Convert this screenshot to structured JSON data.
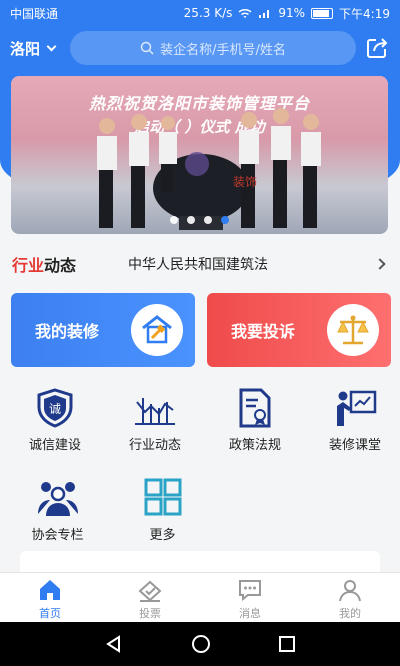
{
  "status_bar": {
    "carrier": "中国联通",
    "speed": "25.3 K/s",
    "battery": "91%",
    "battery_level": 0.91,
    "time": "下午4:19"
  },
  "header": {
    "city": "洛阳",
    "search_placeholder": "装企名称/手机号/姓名",
    "share_icon": "share-icon"
  },
  "banner": {
    "title": "热烈祝贺洛阳市装饰管理平台",
    "subtitle": "启动（   ）仪式        成功",
    "slide_count": 4,
    "active_slide": 4
  },
  "news": {
    "logo_part1": "行业",
    "logo_part2": "动态",
    "headline": "中华人民共和国建筑法"
  },
  "action_cards": [
    {
      "label": "我的装修",
      "icon": "house-hammer-icon"
    },
    {
      "label": "我要投诉",
      "icon": "scales-icon"
    }
  ],
  "grid": [
    {
      "label": "诚信建设",
      "icon": "shield-icon"
    },
    {
      "label": "行业动态",
      "icon": "chart-icon"
    },
    {
      "label": "政策法规",
      "icon": "document-icon"
    },
    {
      "label": "装修课堂",
      "icon": "classroom-icon"
    },
    {
      "label": "协会专栏",
      "icon": "people-icon"
    },
    {
      "label": "更多",
      "icon": "grid-icon"
    }
  ],
  "tabs": [
    {
      "label": "首页",
      "icon": "home-icon",
      "active": true
    },
    {
      "label": "投票",
      "icon": "vote-icon",
      "active": false
    },
    {
      "label": "消息",
      "icon": "message-icon",
      "active": false
    },
    {
      "label": "我的",
      "icon": "user-icon",
      "active": false
    }
  ],
  "colors": {
    "brand_blue": "#2f7df0",
    "complaint_red": "#ef4b4b"
  }
}
